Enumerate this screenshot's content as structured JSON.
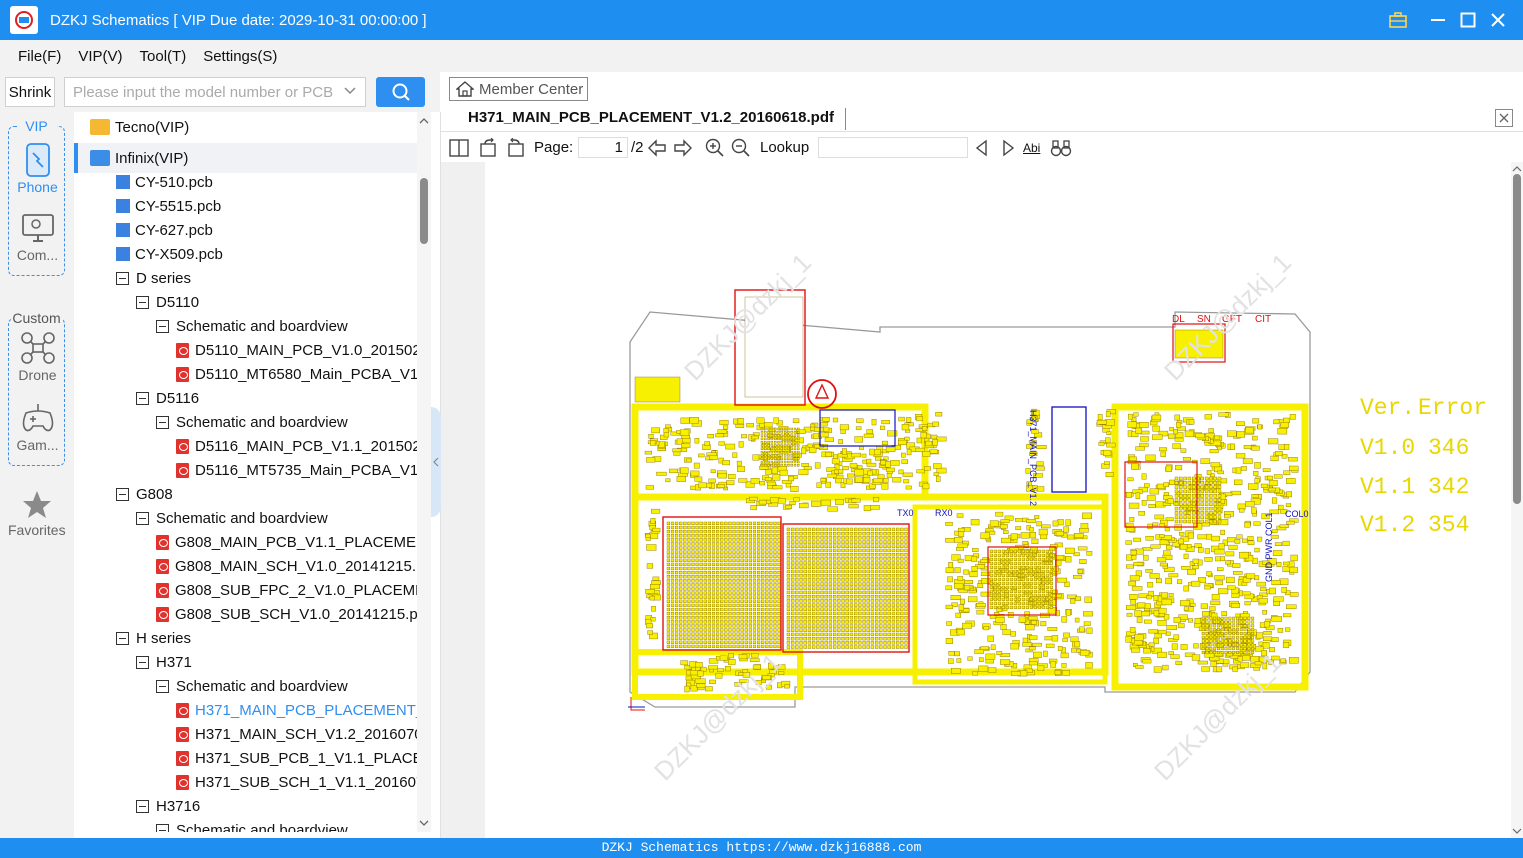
{
  "window": {
    "title": "DZKJ Schematics [ VIP Due date: 2029-10-31 00:00:00 ]"
  },
  "menu": [
    "File(F)",
    "VIP(V)",
    "Tool(T)",
    "Settings(S)"
  ],
  "left_toolbar": {
    "shrink_label": "Shrink",
    "search_placeholder": "Please input the model number or PCB"
  },
  "categories": {
    "vip_label": "VIP",
    "phone": "Phone",
    "computer": "Com...",
    "custom_label": "Custom",
    "drone": "Drone",
    "game": "Gam...",
    "favorites": "Favorites"
  },
  "tree": [
    {
      "label": "Tecno(VIP)",
      "kind": "folder-yellow",
      "level": 0
    },
    {
      "label": "Infinix(VIP)",
      "kind": "folder-blue",
      "level": 0,
      "selected": true
    },
    {
      "label": "CY-510.pcb",
      "kind": "pcb",
      "level": 2
    },
    {
      "label": "CY-5515.pcb",
      "kind": "pcb",
      "level": 2
    },
    {
      "label": "CY-627.pcb",
      "kind": "pcb",
      "level": 2
    },
    {
      "label": "CY-X509.pcb",
      "kind": "pcb",
      "level": 2
    },
    {
      "label": "D series",
      "kind": "expander",
      "level": 2
    },
    {
      "label": "D5110",
      "kind": "expander",
      "level": 3
    },
    {
      "label": "Schematic and boardview",
      "kind": "expander",
      "level": 4
    },
    {
      "label": "D5110_MAIN_PCB_V1.0_20150210",
      "kind": "pdf",
      "level": 5
    },
    {
      "label": "D5110_MT6580_Main_PCBA_V1_S",
      "kind": "pdf",
      "level": 5
    },
    {
      "label": "D5116",
      "kind": "expander",
      "level": 3
    },
    {
      "label": "Schematic and boardview",
      "kind": "expander",
      "level": 4
    },
    {
      "label": "D5116_MAIN_PCB_V1.1_20150212",
      "kind": "pdf",
      "level": 5
    },
    {
      "label": "D5116_MT5735_Main_PCBA_V1_S",
      "kind": "pdf",
      "level": 5
    },
    {
      "label": "G808",
      "kind": "expander",
      "level": 2
    },
    {
      "label": "Schematic and boardview",
      "kind": "expander",
      "level": 3
    },
    {
      "label": "G808_MAIN_PCB_V1.1_PLACEMENT.p",
      "kind": "pdf",
      "level": 4
    },
    {
      "label": "G808_MAIN_SCH_V1.0_20141215.pdf",
      "kind": "pdf",
      "level": 4
    },
    {
      "label": "G808_SUB_FPC_2_V1.0_PLACEMENT.p",
      "kind": "pdf",
      "level": 4
    },
    {
      "label": "G808_SUB_SCH_V1.0_20141215.pdf",
      "kind": "pdf",
      "level": 4
    },
    {
      "label": "H series",
      "kind": "expander",
      "level": 2
    },
    {
      "label": "H371",
      "kind": "expander",
      "level": 3
    },
    {
      "label": "Schematic and boardview",
      "kind": "expander",
      "level": 4
    },
    {
      "label": "H371_MAIN_PCB_PLACEMENT_V1",
      "kind": "pdf",
      "level": 5,
      "active": true
    },
    {
      "label": "H371_MAIN_SCH_V1.2_20160707.p",
      "kind": "pdf",
      "level": 5
    },
    {
      "label": "H371_SUB_PCB_1_V1.1_PLACEMEI",
      "kind": "pdf",
      "level": 5
    },
    {
      "label": "H371_SUB_SCH_1_V1.1_20160707.",
      "kind": "pdf",
      "level": 5
    },
    {
      "label": "H3716",
      "kind": "expander",
      "level": 3
    },
    {
      "label": "Schematic and boardview",
      "kind": "expander",
      "level": 4
    }
  ],
  "member_center": "Member Center",
  "document": {
    "tab_title": "H371_MAIN_PCB_PLACEMENT_V1.2_20160618.pdf",
    "page_label": "Page:",
    "page_current": "1",
    "page_total": "/2",
    "lookup_label": "Lookup",
    "lookup_value": ""
  },
  "pdf_content": {
    "version_table": {
      "headers": [
        "Ver.",
        "Error"
      ],
      "rows": [
        [
          "V1.0",
          "346"
        ],
        [
          "V1.1",
          "342"
        ],
        [
          "V1.2",
          "354"
        ]
      ]
    },
    "board_labels": [
      "DL",
      "SN",
      "GFT",
      "CIT",
      "H371_MAIN_PCB_V1.2",
      "TX0",
      "RX0",
      "COL0",
      "GND PWR COL1"
    ],
    "watermarks": [
      "DZKJ@dzkj_1"
    ]
  },
  "status_bar": "DZKJ Schematics https://www.dzkj16888.com",
  "colors": {
    "accent": "#1e8ef0",
    "board_yellow": "#f7f000",
    "board_red": "#e01010",
    "board_blue": "#1010c0"
  }
}
